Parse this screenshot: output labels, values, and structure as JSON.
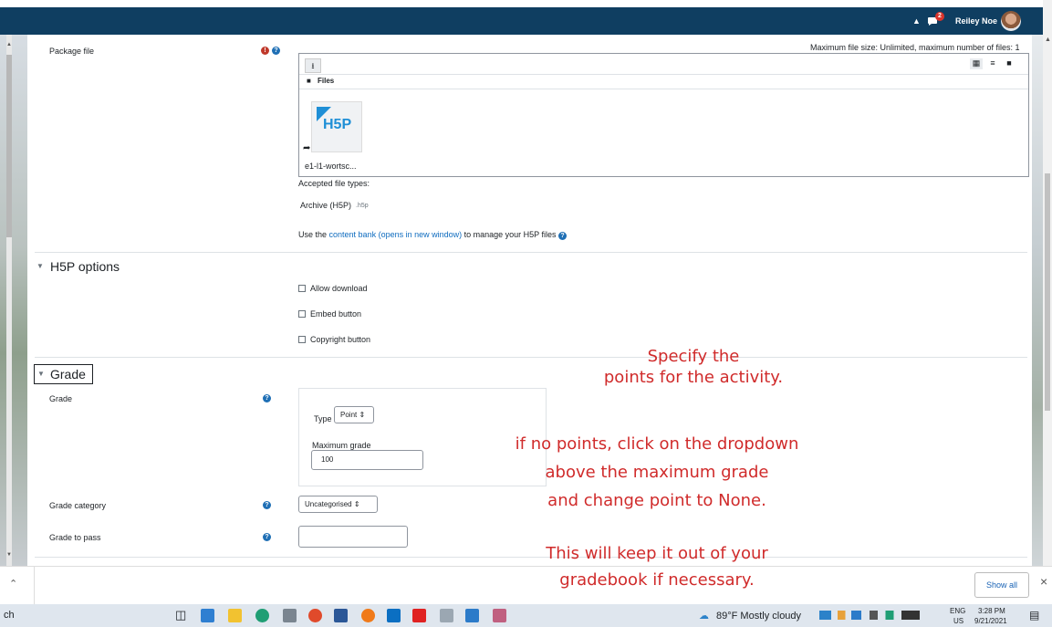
{
  "header": {
    "user_name": "Reiley Noe",
    "notification_count": "2"
  },
  "package": {
    "label": "Package file",
    "max_size": "Maximum file size: Unlimited, maximum number of files: 1",
    "files_label": "Files",
    "file_name": "e1-l1-wortsc...",
    "file_icon_text": "H5P",
    "accepted_label": "Accepted file types:",
    "accepted_type": "Archive (H5P)",
    "accepted_ext": ".h5p",
    "bank_prefix": "Use the ",
    "bank_link": "content bank (opens in new window)",
    "bank_suffix": " to manage your H5P files"
  },
  "h5p_options": {
    "title": "H5P options",
    "options": [
      "Allow download",
      "Embed button",
      "Copyright button"
    ]
  },
  "grade": {
    "section_title": "Grade",
    "grade_label": "Grade",
    "type_label": "Type",
    "type_value": "Point",
    "max_grade_label": "Maximum grade",
    "max_grade_value": "100",
    "category_label": "Grade category",
    "category_value": "Uncategorised",
    "pass_label": "Grade to pass",
    "pass_value": ""
  },
  "annotation": {
    "line1": "Specify the",
    "line2": "points for the activity.",
    "line3": "if no points, click on the dropdown",
    "line4": "above the maximum grade",
    "line5": "and change point to None.",
    "line6": "This will keep it out of your",
    "line7": "gradebook if necessary."
  },
  "bottom": {
    "show_all": "Show all",
    "close": "×",
    "left_text": "ch"
  },
  "taskbar": {
    "weather": "89°F  Mostly cloudy",
    "lang1": "ENG",
    "lang2": "US",
    "time": "3:28 PM",
    "date": "9/21/2021"
  },
  "colors": {
    "nav": "#0f3e61",
    "annotation": "#d02b2b",
    "link": "#0f6cbf"
  }
}
